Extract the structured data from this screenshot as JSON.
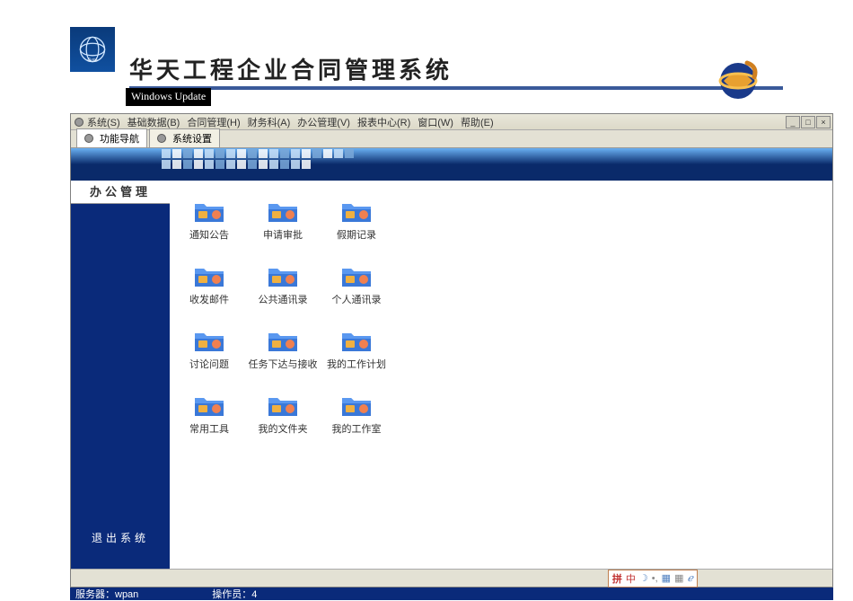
{
  "header": {
    "logo_alt": "Goto",
    "title": "华天工程企业合同管理系统",
    "subtitle": "Windows Update"
  },
  "menubar": {
    "items": [
      "系统(S)",
      "基础数据(B)",
      "合同管理(H)",
      "财务科(A)",
      "办公管理(V)",
      "报表中心(R)",
      "窗口(W)",
      "帮助(E)"
    ]
  },
  "tabs": [
    {
      "label": "功能导航",
      "active": true
    },
    {
      "label": "系统设置",
      "active": false
    }
  ],
  "sidebar": {
    "header": "办公管理",
    "exit": "退出系统"
  },
  "content": {
    "icons": [
      {
        "label": "通知公告"
      },
      {
        "label": "申请审批"
      },
      {
        "label": "假期记录"
      },
      {
        "label": "收发邮件"
      },
      {
        "label": "公共通讯录"
      },
      {
        "label": "个人通讯录"
      },
      {
        "label": "讨论问题"
      },
      {
        "label": "任务下达与接收"
      },
      {
        "label": "我的工作计划"
      },
      {
        "label": "常用工具"
      },
      {
        "label": "我的文件夹"
      },
      {
        "label": "我的工作室"
      }
    ]
  },
  "tray": {
    "chars": [
      "拼",
      "中",
      "☽",
      "•,",
      "▦",
      "▦",
      "ℯ"
    ]
  },
  "status": {
    "server_label": "服务器：",
    "server_value": "wpan",
    "operator_label": "操作员：",
    "operator_value": "4"
  }
}
